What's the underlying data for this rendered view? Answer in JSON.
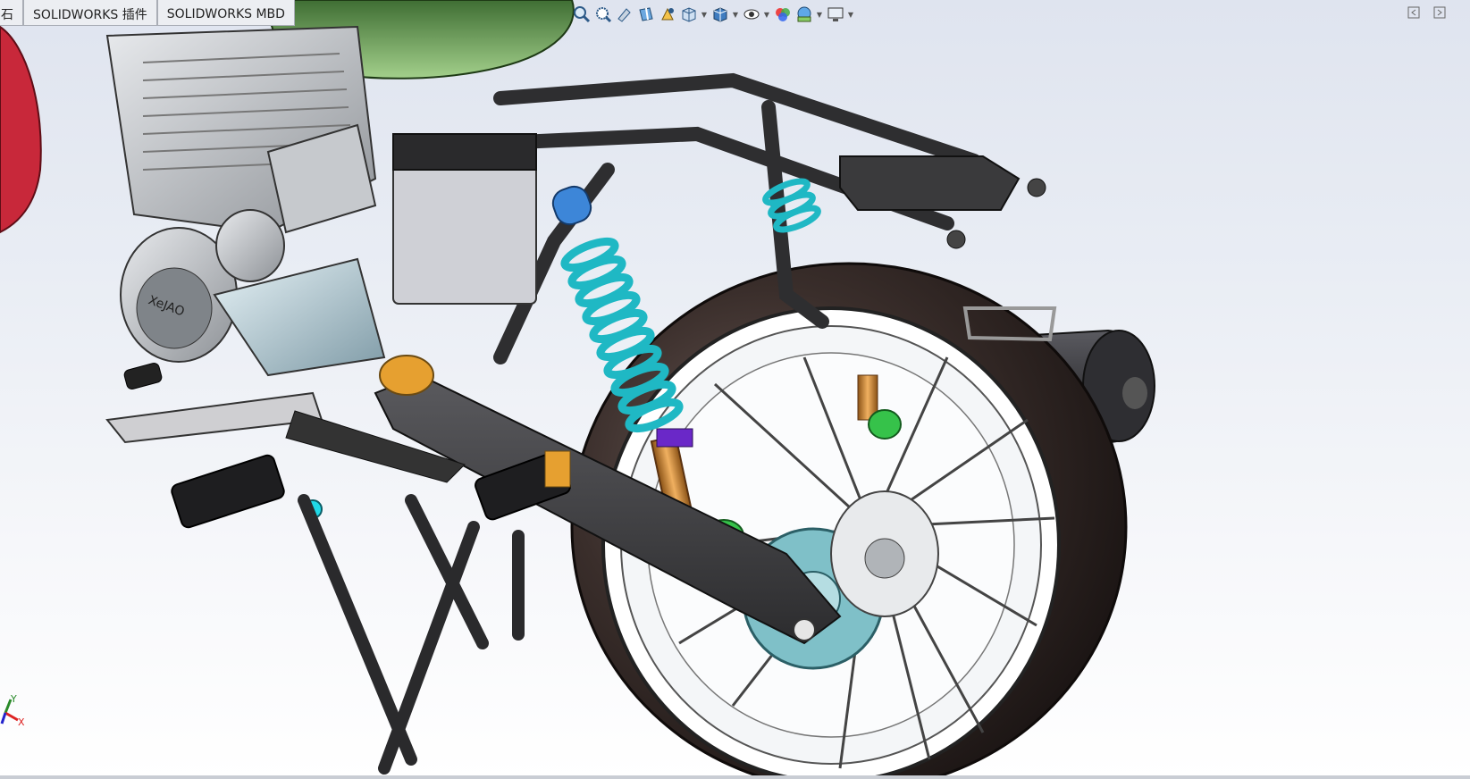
{
  "tabs": [
    {
      "label": "石",
      "partial": true
    },
    {
      "label": "SOLIDWORKS 插件"
    },
    {
      "label": "SOLIDWORKS MBD"
    }
  ],
  "hud_toolbar": {
    "icons": [
      "zoom-to-fit-icon",
      "zoom-to-area-icon",
      "previous-view-icon",
      "section-view-icon",
      "dynamic-annotation-view-icon",
      "view-orientation-icon",
      "display-style-icon",
      "hide-show-items-icon",
      "edit-appearance-icon",
      "apply-scene-icon",
      "view-settings-icon"
    ]
  },
  "window_controls": [
    "restore-window-icon",
    "maximize-window-icon"
  ],
  "triad": {
    "x_label": "X",
    "y_label": "Y"
  },
  "model": {
    "name": "motorcycle rear suspension assembly",
    "brand_text": "XeJAO",
    "colors": {
      "frame": "#3c3c3e",
      "spring": "#20d8e6",
      "damper": "#d08a2a",
      "mount_blue": "#3d86d8",
      "bushing_green": "#36c24a",
      "sprocket": "#7fc0c8",
      "tire": "#2a2220",
      "fender_green": "#5f9a4a",
      "tank_red": "#c8283a",
      "battery": "#c9c9cf",
      "engine": "#bfc3c8"
    }
  }
}
